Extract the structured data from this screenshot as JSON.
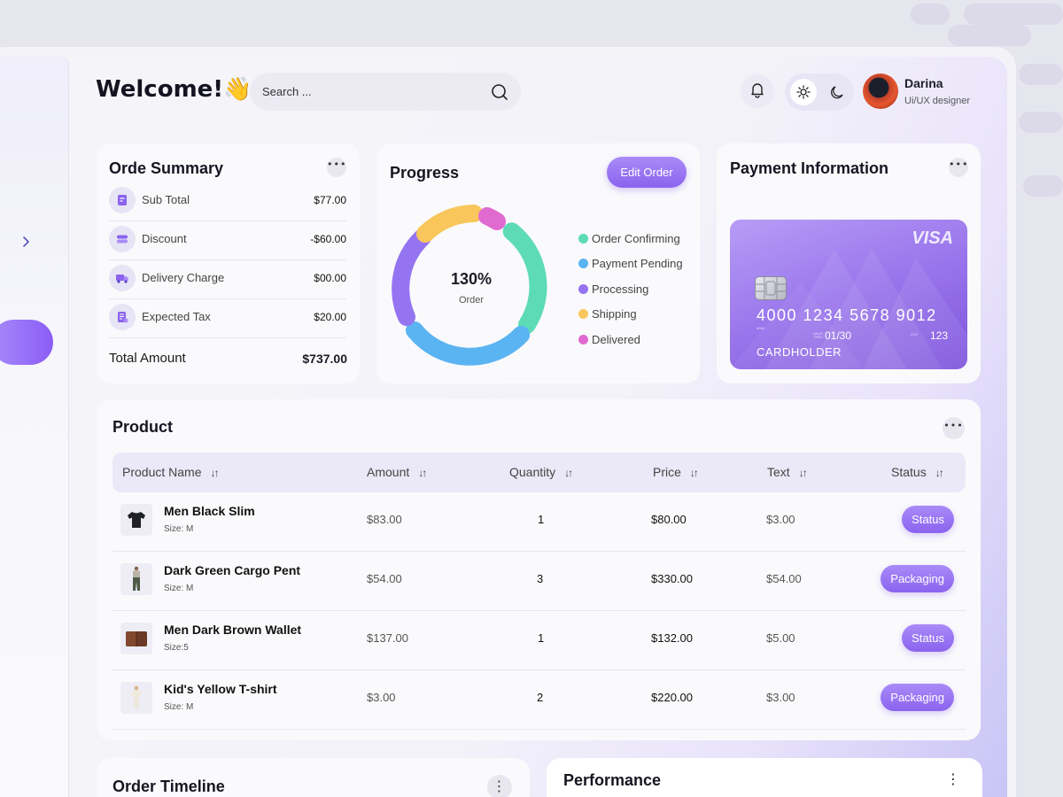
{
  "header": {
    "welcome": "Welcome!👋",
    "search_placeholder": "Search ...",
    "user_name": "Darina",
    "user_role": "Ui/UX designer"
  },
  "order_summary": {
    "title": "Orde Summary",
    "rows": [
      {
        "label": "Sub Total",
        "value": "$77.00",
        "icon": "receipt-icon"
      },
      {
        "label": "Discount",
        "value": "-$60.00",
        "icon": "discount-icon"
      },
      {
        "label": "Delivery Charge",
        "value": "$00.00",
        "icon": "truck-icon"
      },
      {
        "label": "Expected Tax",
        "value": "$20.00",
        "icon": "tax-icon"
      }
    ],
    "total_label": "Total Amount",
    "total_value": "$737.00"
  },
  "progress": {
    "title": "Progress",
    "edit_button": "Edit Order",
    "center_value": "130%",
    "center_label": "Order",
    "legend": [
      {
        "label": "Order Confirming",
        "color": "#5ddbb6"
      },
      {
        "label": "Payment Pending",
        "color": "#5bb4f2"
      },
      {
        "label": "Processing",
        "color": "#9574f2"
      },
      {
        "label": "Shipping",
        "color": "#f8c65a"
      },
      {
        "label": "Delivered",
        "color": "#e06ad0"
      }
    ]
  },
  "payment": {
    "title": "Payment Information",
    "brand": "VISA",
    "number": "4000  1234  5678  9012",
    "number_prefix": "4000",
    "expiry_label": "VALID THRU",
    "expiry": "01/30",
    "cvv_label": "CVV",
    "cvv": "123",
    "holder": "CARDHOLDER"
  },
  "product": {
    "title": "Product",
    "columns": [
      "Product Name",
      "Amount",
      "Quantity",
      "Price",
      "Text",
      "Status"
    ],
    "rows": [
      {
        "name": "Men Black Slim",
        "size": "Size: M",
        "amount": "$83.00",
        "quantity": "1",
        "price": "$80.00",
        "text": "$3.00",
        "status": "Status"
      },
      {
        "name": "Dark Green Cargo Pent",
        "size": "Size: M",
        "amount": "$54.00",
        "quantity": "3",
        "price": "$330.00",
        "text": "$54.00",
        "status": "Packaging"
      },
      {
        "name": "Men Dark Brown Wallet",
        "size": "Size:5",
        "amount": "$137.00",
        "quantity": "1",
        "price": "$132.00",
        "text": "$5.00",
        "status": "Status"
      },
      {
        "name": "Kid's Yellow T-shirt",
        "size": "Size: M",
        "amount": "$3.00",
        "quantity": "2",
        "price": "$220.00",
        "text": "$3.00",
        "status": "Packaging"
      }
    ]
  },
  "order_timeline": {
    "title": "Order Timeline"
  },
  "performance": {
    "title": "Performance"
  },
  "colors": {
    "accent": "#8b63ee",
    "background": "#f3f3f8"
  }
}
